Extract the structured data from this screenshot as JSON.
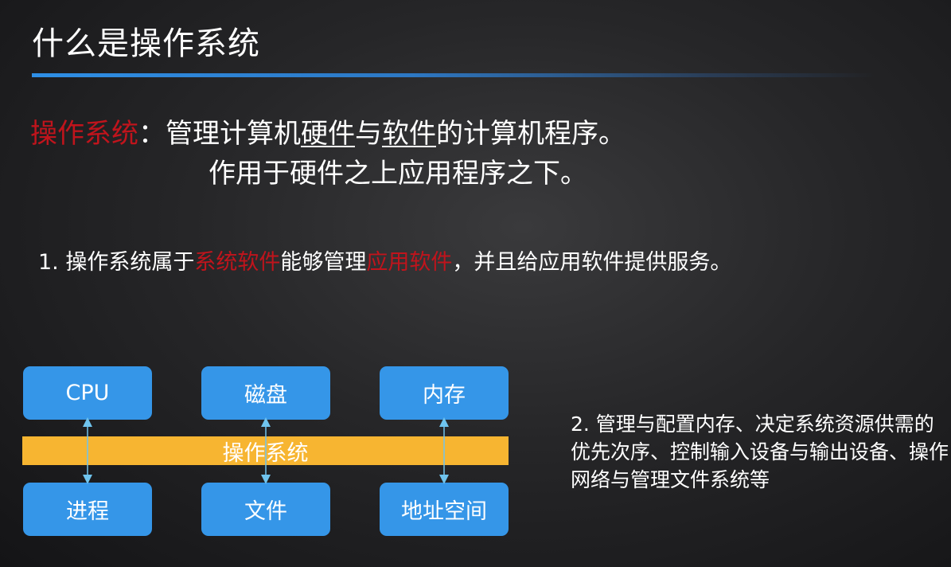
{
  "slide": {
    "title": "什么是操作系统"
  },
  "definition": {
    "term": "操作系统",
    "colon": "：",
    "part1": "管理计算机",
    "hardware": "硬件",
    "part2": "与",
    "software": "软件",
    "part3": "的计算机程序。",
    "line2": "作用于硬件之上应用程序之下。"
  },
  "point1": {
    "prefix": "1. 操作系统属于",
    "system_software": "系统软件",
    "middle": "能够管理",
    "app_software": "应用软件",
    "suffix": "，并且给应用软件提供服务。"
  },
  "diagram": {
    "top_boxes": [
      "CPU",
      "磁盘",
      "内存"
    ],
    "os_bar": "操作系统",
    "bottom_boxes": [
      "进程",
      "文件",
      "地址空间"
    ]
  },
  "point2": {
    "text": "2. 管理与配置内存、决定系统资源供需的优先次序、控制输入设备与输出设备、操作网络与管理文件系统等"
  },
  "colors": {
    "accent_red": "#c0141c",
    "box_blue": "#3596e8",
    "bar_yellow": "#f7b531",
    "rule_blue": "#2e8fe6",
    "connector": "#6fc4ee"
  }
}
